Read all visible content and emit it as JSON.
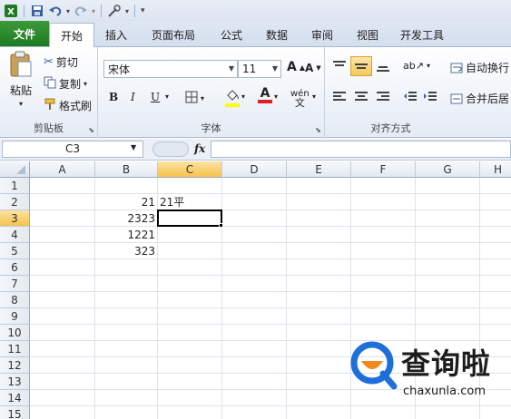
{
  "quick_access": {
    "icons": [
      "excel-icon",
      "save-icon",
      "undo-icon",
      "redo-icon",
      "tools-icon",
      "customize-icon"
    ]
  },
  "tabs": [
    {
      "label": "文件",
      "id": "file"
    },
    {
      "label": "开始",
      "id": "home"
    },
    {
      "label": "插入",
      "id": "insert"
    },
    {
      "label": "页面布局",
      "id": "page-layout"
    },
    {
      "label": "公式",
      "id": "formulas"
    },
    {
      "label": "数据",
      "id": "data"
    },
    {
      "label": "审阅",
      "id": "review"
    },
    {
      "label": "视图",
      "id": "view"
    },
    {
      "label": "开发工具",
      "id": "developer"
    }
  ],
  "clipboard": {
    "paste": "粘贴",
    "cut": "剪切",
    "copy": "复制",
    "format_painter": "格式刷",
    "label": "剪贴板"
  },
  "font": {
    "name": "宋体",
    "size": "11",
    "label": "字体",
    "bold": "B",
    "italic": "I",
    "underline": "U",
    "grow": "A",
    "shrink": "A",
    "font_color_letter": "A",
    "phonetic": "wén",
    "fill_color": "#ffff00",
    "text_color": "#e02020"
  },
  "alignment": {
    "label": "对齐方式",
    "wrap_text": "自动换行",
    "merge_center": "合并后居"
  },
  "formula_bar": {
    "name_box": "C3",
    "fx": "fx",
    "value": ""
  },
  "columns": [
    "A",
    "B",
    "C",
    "D",
    "E",
    "F",
    "G",
    "H"
  ],
  "rows": [
    "1",
    "2",
    "3",
    "4",
    "5",
    "6",
    "7",
    "8",
    "9",
    "10",
    "11",
    "12",
    "13",
    "14",
    "15"
  ],
  "cells": {
    "B2": "21",
    "C2": "21平",
    "B3": "2323",
    "B4": "1221",
    "B5": "323"
  },
  "active_cell": "C3",
  "watermark": {
    "text": "查询啦",
    "url": "chaxunla.com",
    "colors": {
      "blue": "#1e6fd9",
      "orange": "#f28a1b"
    }
  }
}
